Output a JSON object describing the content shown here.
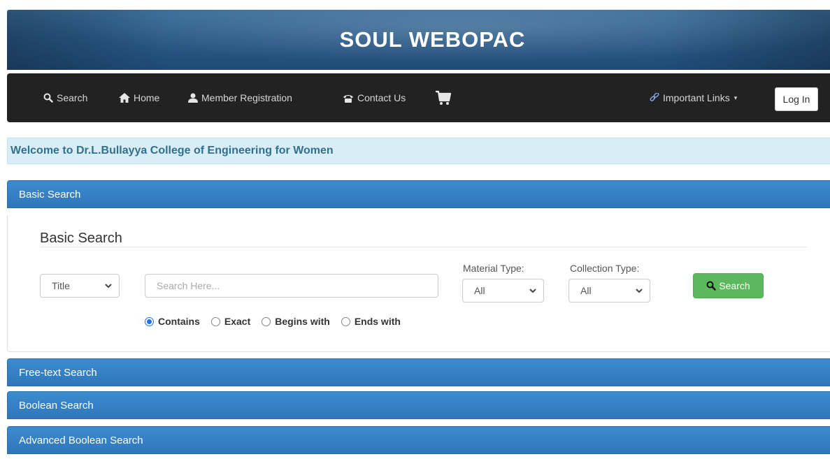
{
  "banner": {
    "title": "SOUL WEBOPAC"
  },
  "nav": {
    "search": "Search",
    "home": "Home",
    "member_registration": "Member Registration",
    "contact_us": "Contact Us",
    "important_links": "Important Links",
    "login": "Log In"
  },
  "welcome": "Welcome to Dr.L.Bullayya College of Engineering for Women",
  "panels": {
    "basic": "Basic Search",
    "free_text": "Free-text Search",
    "boolean": "Boolean Search",
    "advanced_boolean": "Advanced Boolean Search"
  },
  "basic_search": {
    "heading": "Basic Search",
    "field_select": "Title",
    "search_placeholder": "Search Here...",
    "material_type_label": "Material Type:",
    "material_type_value": "All",
    "collection_type_label": "Collection Type:",
    "collection_type_value": "All",
    "search_button": "Search",
    "match_options": [
      "Contains",
      "Exact",
      "Begins with",
      "Ends with"
    ],
    "selected_match": "Contains"
  },
  "colors": {
    "navbar": "#222222",
    "panel_header": "#337ab7",
    "welcome_bg": "#d9edf7",
    "search_button": "#5cb85c"
  }
}
